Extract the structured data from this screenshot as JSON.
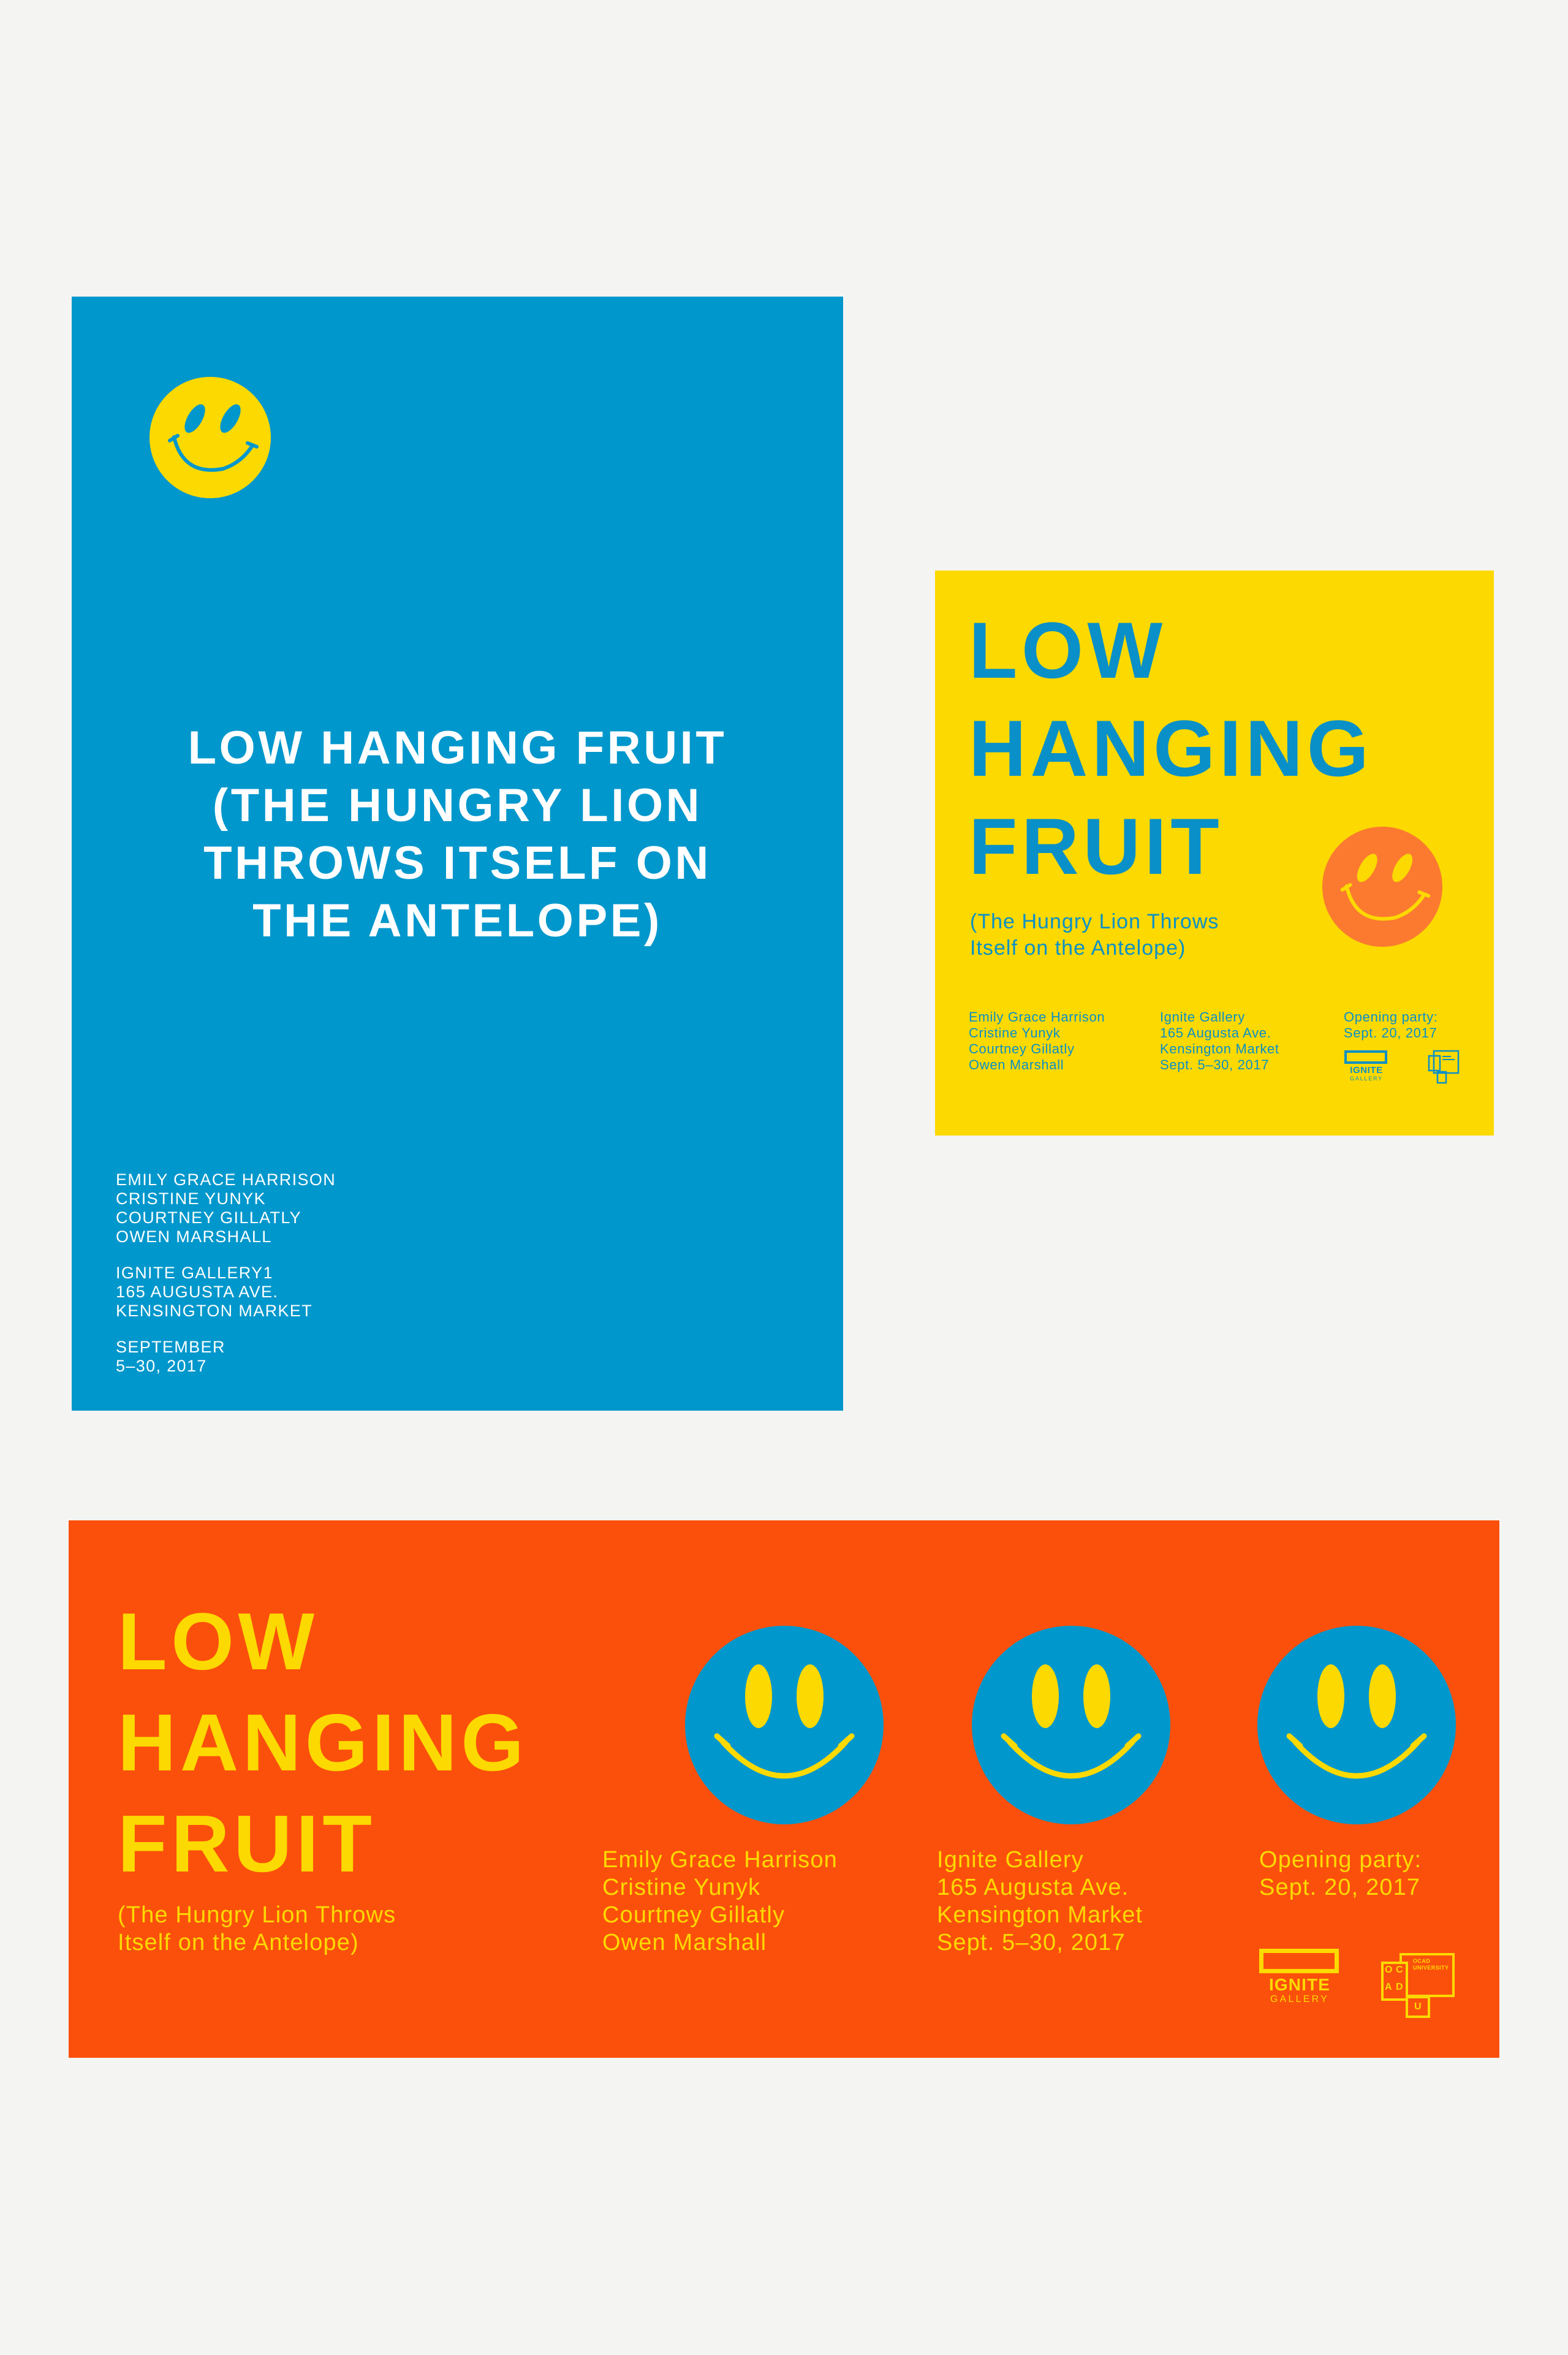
{
  "colors": {
    "background": "#f4f4f3",
    "blue": "#0097cc",
    "yellow": "#fcd900",
    "orange": "#fb500c"
  },
  "blue_poster": {
    "title_lines": [
      "LOW HANGING FRUIT",
      "(THE HUNGRY LION",
      "THROWS ITSELF ON",
      "THE ANTELOPE)"
    ],
    "artists": [
      "EMILY GRACE HARRISON",
      "CRISTINE YUNYK",
      "COURTNEY GILLATLY",
      "OWEN MARSHALL"
    ],
    "venue": [
      "IGNITE GALLERY1",
      "165 AUGUSTA AVE.",
      "KENSINGTON MARKET"
    ],
    "dates": [
      "SEPTEMBER",
      "5–30, 2017"
    ],
    "icon": "smiley-face-icon"
  },
  "yellow_poster": {
    "title_lines": [
      "LOW",
      "HANGING",
      "FRUIT"
    ],
    "subtitle_lines": [
      "(The Hungry Lion Throws",
      "Itself on the Antelope)"
    ],
    "artists": [
      "Emily Grace Harrison",
      "Cristine Yunyk",
      "Courtney Gillatly",
      "Owen Marshall"
    ],
    "venue": [
      "Ignite Gallery",
      "165 Augusta Ave.",
      "Kensington Market",
      "Sept. 5–30, 2017"
    ],
    "opening": [
      "Opening party:",
      "Sept. 20, 2017"
    ],
    "logo_ignite": {
      "name": "IGNITE",
      "sub": "GALLERY"
    },
    "icon": "smiley-face-icon"
  },
  "orange_poster": {
    "title_lines": [
      "LOW",
      "HANGING",
      "FRUIT"
    ],
    "subtitle_lines": [
      "(The Hungry Lion Throws",
      "Itself on the Antelope)"
    ],
    "artists": [
      "Emily Grace Harrison",
      "Cristine Yunyk",
      "Courtney Gillatly",
      "Owen Marshall"
    ],
    "venue": [
      "Ignite Gallery",
      "165 Augusta Ave.",
      "Kensington Market",
      "Sept. 5–30, 2017"
    ],
    "opening": [
      "Opening party:",
      "Sept. 20, 2017"
    ],
    "logo_ignite": {
      "name": "IGNITE",
      "sub": "GALLERY"
    },
    "logo_ocad": {
      "letters": [
        "O",
        "C",
        "A",
        "D",
        "U"
      ],
      "small": [
        "OCAD",
        "UNIVERSITY"
      ]
    },
    "icon": "smiley-face-icon"
  }
}
